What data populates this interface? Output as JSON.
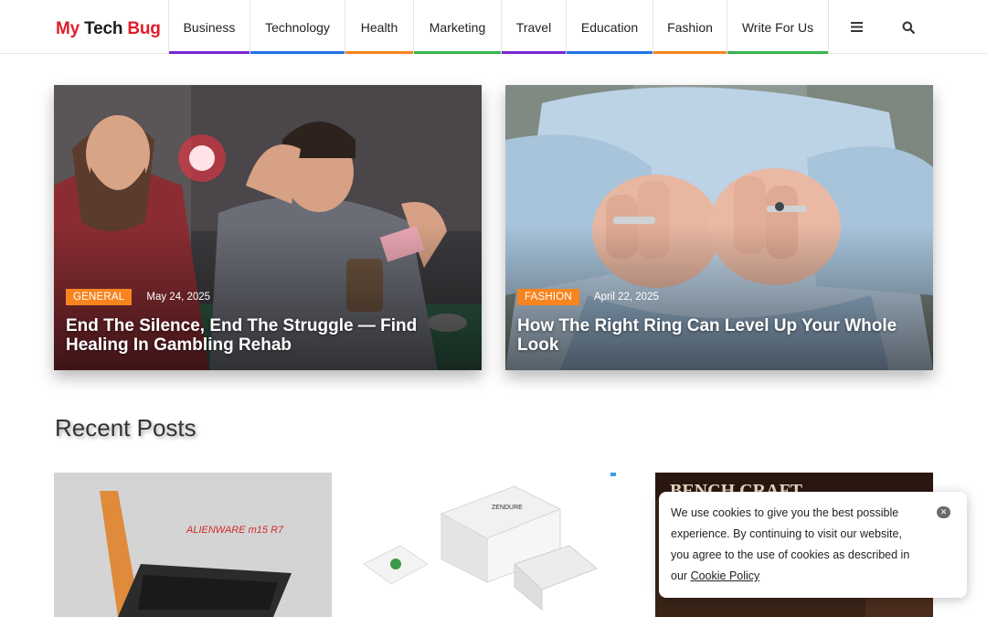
{
  "logo": {
    "part1": "My",
    "part2": "Tech",
    "part3": "Bug"
  },
  "nav": {
    "items": [
      {
        "label": "Business",
        "color": "#7b27d6"
      },
      {
        "label": "Technology",
        "color": "#1e73e8"
      },
      {
        "label": "Health",
        "color": "#f7841f"
      },
      {
        "label": "Marketing",
        "color": "#37b24d"
      },
      {
        "label": "Travel",
        "color": "#7b27d6"
      },
      {
        "label": "Education",
        "color": "#1e73e8"
      },
      {
        "label": "Fashion",
        "color": "#f7841f"
      },
      {
        "label": "Write For Us",
        "color": "#37b24d"
      }
    ],
    "menu_icon": "hamburger-icon",
    "search_icon": "search-icon"
  },
  "featured": [
    {
      "category": "GENERAL",
      "date": "May 24, 2025",
      "title": "End The Silence, End The Struggle — Find Healing In Gambling Rehab"
    },
    {
      "category": "FASHION",
      "date": "April 22, 2025",
      "title": "How The Right Ring Can Level Up Your Whole Look"
    }
  ],
  "recent": {
    "heading": "Recent Posts",
    "thumbs": [
      {
        "caption": "ALIENWARE m15 R7"
      },
      {
        "caption": "ZENDURE"
      },
      {
        "caption": "BENCH CRAFT"
      }
    ]
  },
  "cookie": {
    "text": "We use cookies to give you the best possible experience. By continuing to visit our website, you agree to the use of cookies as described in our",
    "link": "Cookie Policy",
    "close_icon": "close-icon"
  },
  "colors": {
    "accent_red": "#e11d2a",
    "badge": "#f7841f"
  }
}
